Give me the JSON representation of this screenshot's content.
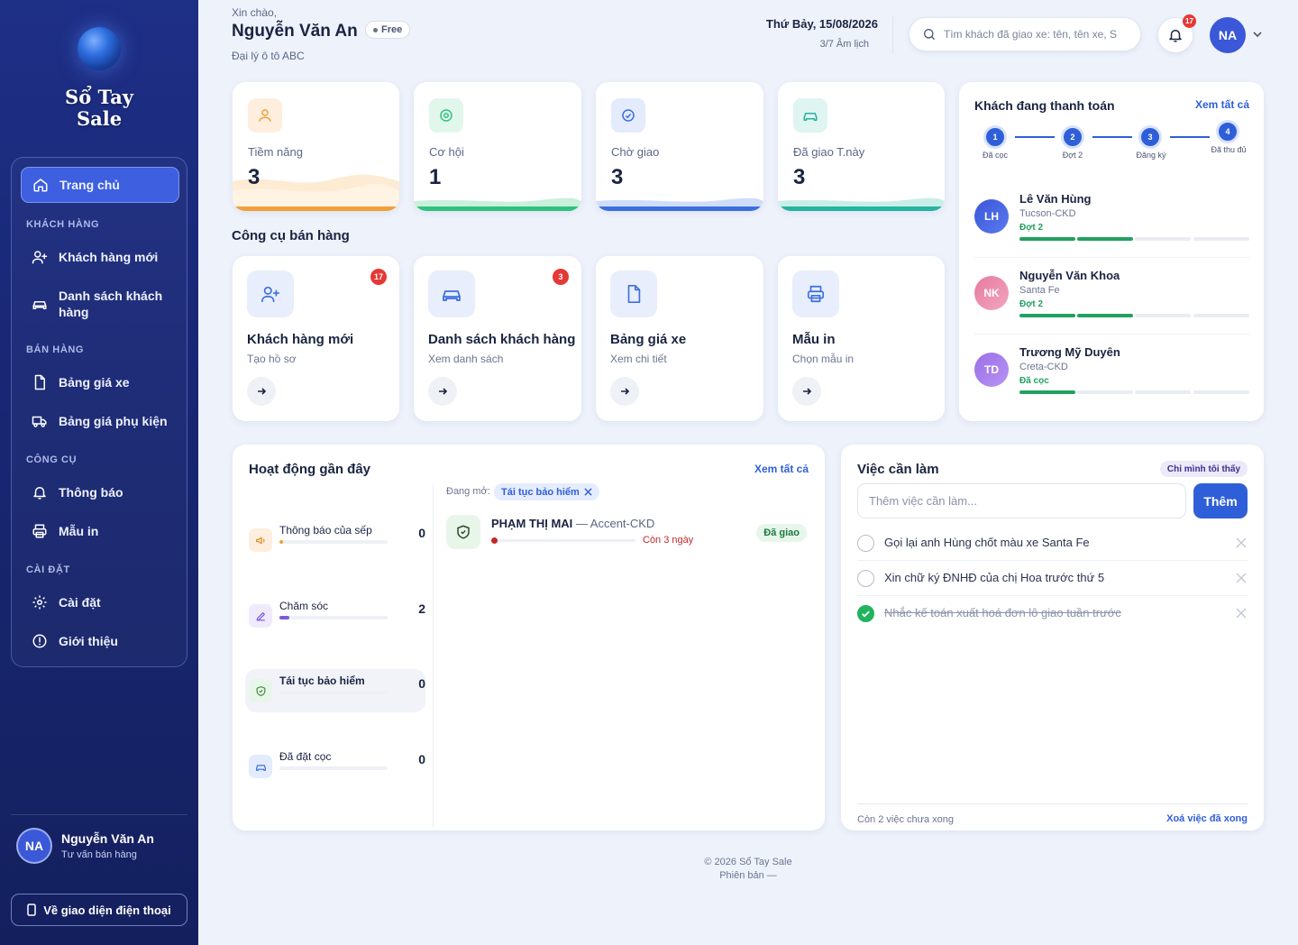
{
  "sidebar": {
    "logo_line1": "Sổ Tay",
    "logo_line2": "Sale",
    "home": "Trang chủ",
    "sections": {
      "customers": "KHÁCH HÀNG",
      "sales": "BÁN HÀNG",
      "tools": "CÔNG CỤ",
      "settings": "CÀI ĐẶT"
    },
    "items": {
      "new_customer": "Khách hàng mới",
      "customer_list": "Danh sách khách hàng",
      "car_prices": "Bảng giá xe",
      "accessory_prices": "Bảng giá phụ kiện",
      "notifications": "Thông báo",
      "print_templates": "Mẫu in",
      "settings": "Cài đặt",
      "about": "Giới thiệu"
    },
    "user": {
      "initials": "NA",
      "name": "Nguyễn Văn An",
      "role": "Tư vấn bán hàng"
    },
    "mobile_button": "Về giao diện điện thoại"
  },
  "header": {
    "greeting": "Xin chào,",
    "name": "Nguyễn Văn An",
    "plan": "Free",
    "agency": "Đại lý ô tô ABC",
    "date": "Thứ Bảy, 15/08/2026",
    "lunar": "3/7 Âm lịch",
    "search_placeholder": "Tìm khách đã giao xe: tên, tên xe, S",
    "notif_count": "17",
    "avatar": "NA"
  },
  "stats": [
    {
      "label": "Tiềm năng",
      "value": "3",
      "color": "#f0a03a"
    },
    {
      "label": "Cơ hội",
      "value": "1",
      "color": "#2ec27e"
    },
    {
      "label": "Chờ giao",
      "value": "3",
      "color": "#3b6fe0"
    },
    {
      "label": "Đã giao T.này",
      "value": "3",
      "color": "#26b3a0"
    }
  ],
  "tools": {
    "title": "Công cụ bán hàng",
    "items": [
      {
        "title": "Khách hàng mới",
        "sub": "Tạo hồ sơ",
        "badge": "17"
      },
      {
        "title": "Danh sách khách hàng",
        "sub": "Xem danh sách",
        "badge": "3"
      },
      {
        "title": "Bảng giá xe",
        "sub": "Xem chi tiết"
      },
      {
        "title": "Mẫu in",
        "sub": "Chọn mẫu in"
      }
    ]
  },
  "paying": {
    "title": "Khách đang thanh toán",
    "view_all": "Xem tất cả",
    "steps": [
      {
        "num": "1",
        "label": "Đã cọc"
      },
      {
        "num": "2",
        "label": "Đợt 2"
      },
      {
        "num": "3",
        "label": "Đăng ký"
      },
      {
        "num": "4",
        "label": "Đã thu đủ"
      }
    ],
    "customers": [
      {
        "initials": "LH",
        "name": "Lê Văn Hùng",
        "car": "Tucson-CKD",
        "stage": "Đợt 2",
        "done": 2,
        "color": "#3a58d8"
      },
      {
        "initials": "NK",
        "name": "Nguyễn Văn Khoa",
        "car": "Santa Fe",
        "stage": "Đợt 2",
        "done": 2,
        "color": "#e77ba0"
      },
      {
        "initials": "TD",
        "name": "Trương Mỹ Duyên",
        "car": "Creta-CKD",
        "stage": "Đã cọc",
        "done": 1,
        "color": "#9b6ee8"
      }
    ]
  },
  "activity": {
    "title": "Hoạt động gần đây",
    "view_all": "Xem tất cả",
    "items": [
      {
        "name": "Thông báo của sếp",
        "count": "0",
        "progress": 0.03,
        "color": "#f0a03a"
      },
      {
        "name": "Chăm sóc",
        "count": "2",
        "progress": 0.09,
        "color": "#7a5ae0"
      },
      {
        "name": "Tái tục bảo hiểm",
        "count": "0",
        "progress": 0,
        "color": "#5aa05a"
      },
      {
        "name": "Đã đặt cọc",
        "count": "0",
        "progress": 0,
        "color": "#3b6fe0"
      }
    ],
    "open_label": "Đang mở:",
    "open_chip": "Tái tục bảo hiểm",
    "record": {
      "name": "PHẠM THỊ MAI",
      "car": " — Accent-CKD",
      "remaining": "Còn 3 ngày",
      "status": "Đã giao"
    }
  },
  "todo": {
    "title": "Việc cần làm",
    "privacy": "Chỉ mình tôi thấy",
    "placeholder": "Thêm việc cần làm...",
    "add_label": "Thêm",
    "items": [
      {
        "text": "Gọi lại anh Hùng chốt màu xe Santa Fe",
        "done": false
      },
      {
        "text": "Xin chữ ký ĐNHĐ của chị Hoa trước thứ 5",
        "done": false
      },
      {
        "text": "Nhắc kế toán xuất hoá đơn lô giao tuần trước",
        "done": true
      }
    ],
    "remaining": "Còn 2 việc chưa xong",
    "clear_done": "Xoá việc đã xong"
  },
  "footer": {
    "copyright": "© 2026 Sổ Tay Sale",
    "version": "Phiên bản —"
  }
}
